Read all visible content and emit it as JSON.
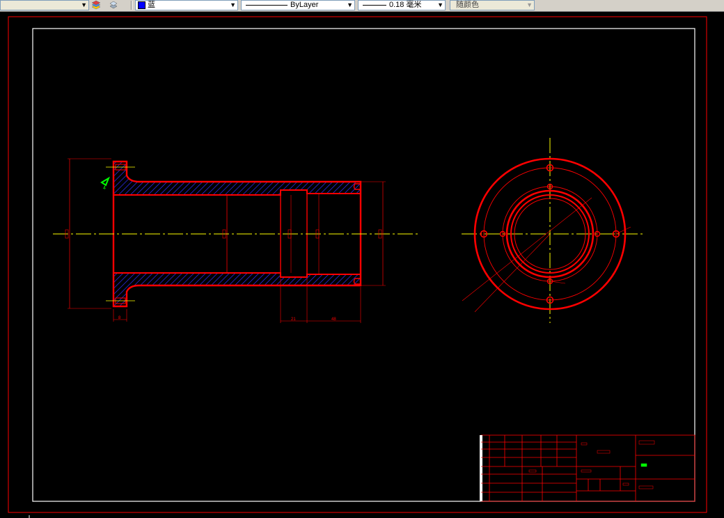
{
  "toolbar": {
    "color_label": "蓝",
    "linetype_label": "ByLayer",
    "lineweight_label": "0.18 毫米",
    "plotstyle_label": "随颜色"
  },
  "colors": {
    "outline": "#ff0000",
    "centerline": "#ffff00",
    "border": "#ffffff",
    "hatch": "#3030ff",
    "marker": "#00ff00",
    "toolbar_bg": "#d4d0c8"
  },
  "drawing": {
    "dim_labels": [
      "8",
      "21",
      "48"
    ],
    "flange_label": "4",
    "icon_names": [
      "layer-stack-icon",
      "layer-prev-icon"
    ]
  }
}
